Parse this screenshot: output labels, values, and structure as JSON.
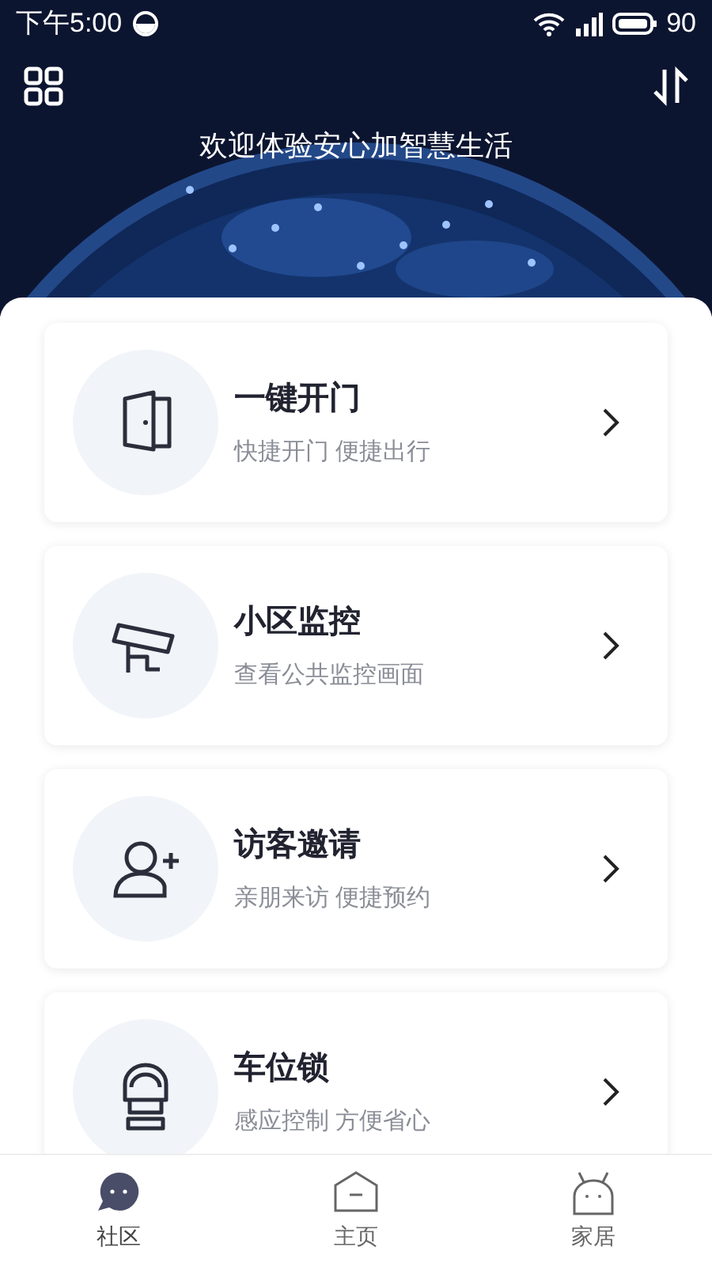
{
  "status_bar": {
    "time": "下午5:00",
    "battery": "90"
  },
  "header": {
    "welcome": "欢迎体验安心加智慧生活"
  },
  "features": [
    {
      "title": "一键开门",
      "subtitle": "快捷开门 便捷出行"
    },
    {
      "title": "小区监控",
      "subtitle": "查看公共监控画面"
    },
    {
      "title": "访客邀请",
      "subtitle": "亲朋来访 便捷预约"
    },
    {
      "title": "车位锁",
      "subtitle": "感应控制 方便省心"
    }
  ],
  "tabs": [
    {
      "label": "社区",
      "selected": true
    },
    {
      "label": "主页",
      "selected": false
    },
    {
      "label": "家居",
      "selected": false
    }
  ]
}
